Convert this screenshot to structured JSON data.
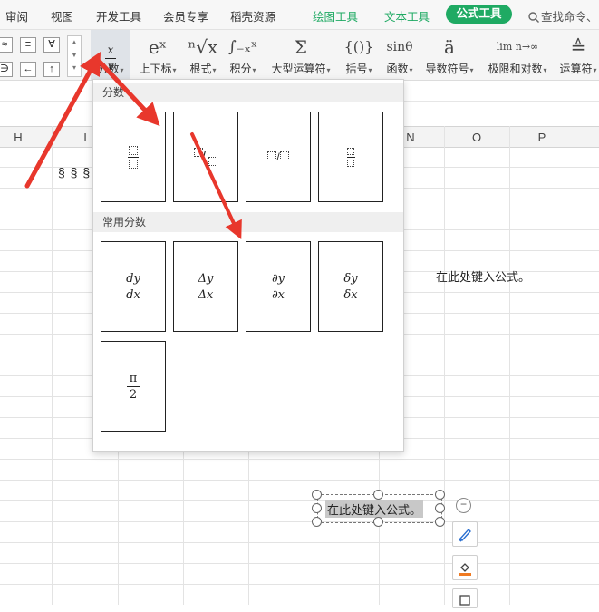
{
  "menubar": {
    "tabs": [
      "审阅",
      "视图",
      "开发工具",
      "会员专享",
      "稻壳资源",
      "绘图工具",
      "文本工具",
      "公式工具"
    ],
    "search_text": "查找命令、"
  },
  "ribbon": {
    "symbols_left": [
      "≈",
      "≡",
      "∀",
      "∋",
      "←",
      "↑"
    ],
    "buttons": [
      {
        "label": "分数",
        "icon": "x/y"
      },
      {
        "label": "上下标",
        "icon": "eˣ"
      },
      {
        "label": "根式",
        "icon": "ⁿ√x"
      },
      {
        "label": "积分",
        "icon": "∫₋ₓˣ"
      },
      {
        "label": "大型运算符",
        "icon": "Σ"
      },
      {
        "label": "括号",
        "icon": "{()}"
      },
      {
        "label": "函数",
        "icon": "sinθ"
      },
      {
        "label": "导数符号",
        "icon": "ä"
      },
      {
        "label": "极限和对数",
        "icon": "lim n→∞"
      },
      {
        "label": "运算符",
        "icon": "≜"
      }
    ]
  },
  "sheet": {
    "columns": [
      "H",
      "I",
      "N",
      "O",
      "P"
    ],
    "cell_text_1": "§ § §",
    "cell_text_2": "在此处键入公式。",
    "formula_object_text": "在此处键入公式。"
  },
  "dropdown": {
    "section1_title": "分数",
    "section2_title": "常用分数",
    "common_fractions": [
      {
        "num": "dy",
        "den": "dx"
      },
      {
        "num": "Δy",
        "den": "Δx"
      },
      {
        "num": "∂y",
        "den": "∂x"
      },
      {
        "num": "δy",
        "den": "δx"
      },
      {
        "num": "π",
        "den": "2"
      }
    ]
  },
  "colors": {
    "accent": "#1faa63",
    "annotation_arrow": "#e8372c"
  }
}
